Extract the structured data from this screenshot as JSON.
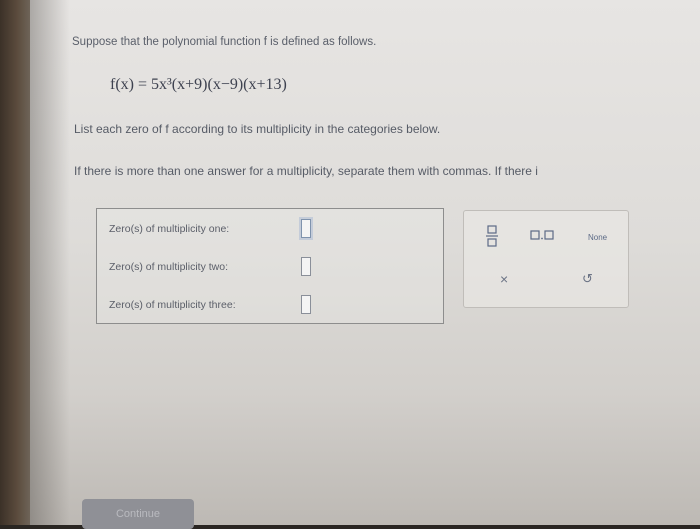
{
  "question": {
    "intro": "Suppose that the polynomial function f is defined as follows.",
    "formula": "f(x) = 5x³(x+9)(x−9)(x+13)",
    "instruction": "List each zero of f according to its multiplicity in the categories below.",
    "instruction2": "If there is more than one answer for a multiplicity, separate them with commas. If there i"
  },
  "answers": [
    {
      "label": "Zero(s) of multiplicity one:",
      "value": ""
    },
    {
      "label": "Zero(s) of multiplicity two:",
      "value": ""
    },
    {
      "label": "Zero(s) of multiplicity three:",
      "value": ""
    }
  ],
  "tools": {
    "fraction_icon": "fraction-icon",
    "mixed_number_icon": "mixed-number-icon",
    "none_label": "None",
    "clear_icon": "×",
    "undo_icon": "↺"
  },
  "continue_label": "Continue"
}
